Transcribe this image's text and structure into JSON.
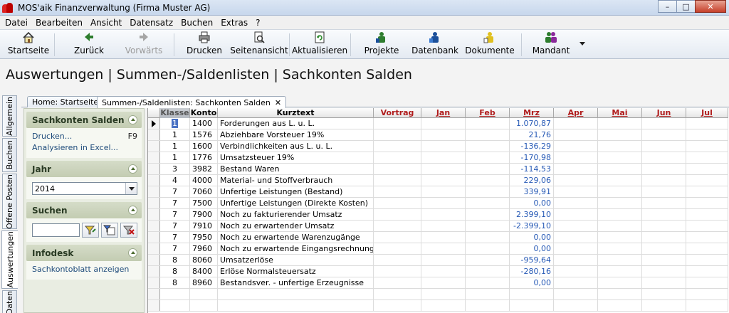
{
  "window": {
    "title": "MOS'aik Finanzverwaltung (Firma Muster AG)"
  },
  "menu": [
    "Datei",
    "Bearbeiten",
    "Ansicht",
    "Datensatz",
    "Buchen",
    "Extras",
    "?"
  ],
  "toolbar": {
    "startseite": "Startseite",
    "zurueck": "Zurück",
    "vorwaerts": "Vorwärts",
    "drucken": "Drucken",
    "seitenansicht": "Seitenansicht",
    "aktualisieren": "Aktualisieren",
    "projekte": "Projekte",
    "datenbank": "Datenbank",
    "dokumente": "Dokumente",
    "mandant": "Mandant"
  },
  "page": {
    "title": "Auswertungen | Summen-/Saldenlisten | Sachkonten Salden"
  },
  "vtabs": [
    "Allgemein",
    "Buchen",
    "Offene Posten",
    "Auswertungen",
    "Daten"
  ],
  "doctabs": {
    "home": "Home: Startseite",
    "current": "Summen-/Saldenlisten: Sachkonten Salden"
  },
  "panel": {
    "sachkonten": {
      "title": "Sachkonten Salden",
      "print": "Drucken...",
      "print_key": "F9",
      "excel": "Analysieren in Excel..."
    },
    "jahr": {
      "title": "Jahr",
      "value": "2014"
    },
    "suchen": {
      "title": "Suchen",
      "value": ""
    },
    "infodesk": {
      "title": "Infodesk",
      "link": "Sachkontoblatt anzeigen"
    }
  },
  "grid": {
    "columns": [
      "Klasse",
      "Konto",
      "Kurztext",
      "Vortrag",
      "Jan",
      "Feb",
      "Mrz",
      "Apr",
      "Mai",
      "Jun",
      "Jul"
    ],
    "rows": [
      [
        "1",
        "1400",
        "Forderungen aus L. u. L.",
        "",
        "",
        "",
        "1.070,87"
      ],
      [
        "1",
        "1576",
        "Abziehbare Vorsteuer 19%",
        "",
        "",
        "",
        "21,76"
      ],
      [
        "1",
        "1600",
        "Verbindlichkeiten aus L. u. L.",
        "",
        "",
        "",
        "-136,29"
      ],
      [
        "1",
        "1776",
        "Umsatzsteuer 19%",
        "",
        "",
        "",
        "-170,98"
      ],
      [
        "3",
        "3982",
        "Bestand Waren",
        "",
        "",
        "",
        "-114,53"
      ],
      [
        "4",
        "4000",
        "Material- und Stoffverbrauch",
        "",
        "",
        "",
        "229,06"
      ],
      [
        "7",
        "7060",
        "Unfertige Leistungen (Bestand)",
        "",
        "",
        "",
        "339,91"
      ],
      [
        "7",
        "7500",
        "Unfertige Leistungen (Direkte Kosten)",
        "",
        "",
        "",
        "0,00"
      ],
      [
        "7",
        "7900",
        "Noch zu fakturierender Umsatz",
        "",
        "",
        "",
        "2.399,10"
      ],
      [
        "7",
        "7910",
        "Noch zu erwartender Umsatz",
        "",
        "",
        "",
        "-2.399,10"
      ],
      [
        "7",
        "7950",
        "Noch zu erwartende Warenzugänge",
        "",
        "",
        "",
        "0,00"
      ],
      [
        "7",
        "7960",
        "Noch zu erwartende Eingangsrechnungen",
        "",
        "",
        "",
        "0,00"
      ],
      [
        "8",
        "8060",
        "Umsatzerlöse",
        "",
        "",
        "",
        "-959,64"
      ],
      [
        "8",
        "8400",
        "Erlöse Normalsteuersatz",
        "",
        "",
        "",
        "-280,16"
      ],
      [
        "8",
        "8960",
        "Bestandsver. - unfertige Erzeugnisse",
        "",
        "",
        "",
        "0,00"
      ]
    ]
  },
  "colors": {
    "accent": "#2659b5",
    "month_header": "#b01c1c",
    "panel_bg": "#e9ede2"
  }
}
